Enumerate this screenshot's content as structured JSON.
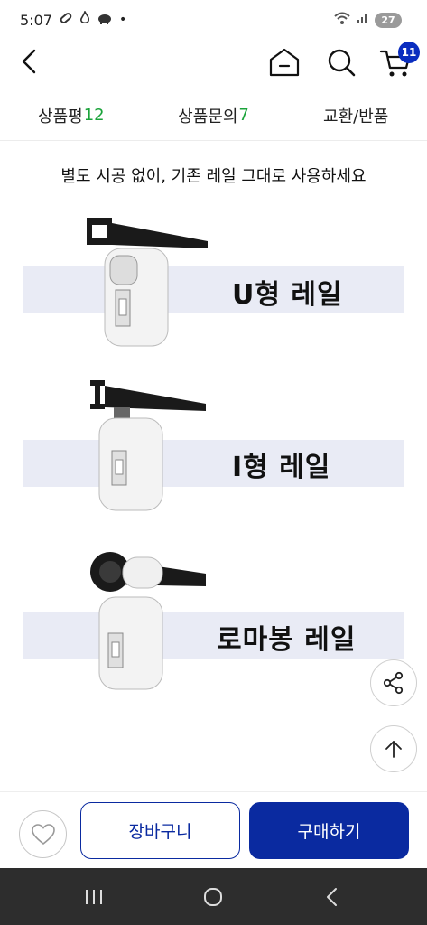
{
  "status_bar": {
    "time": "5:07",
    "dot": "•",
    "battery": "27",
    "icons": [
      "link-icon",
      "fire-icon",
      "piggy-icon",
      "wifi-icon",
      "signal-icon",
      "battery-icon"
    ]
  },
  "header": {
    "cart_count": "11",
    "icons": [
      "back-icon",
      "home-icon",
      "search-icon",
      "cart-icon"
    ]
  },
  "tabs": [
    {
      "label": "상품평",
      "count": "12"
    },
    {
      "label": "상품문의",
      "count": "7"
    },
    {
      "label": "교환/반품",
      "count": ""
    }
  ],
  "content": {
    "intro": "별도 시공 없이, 기존 레일 그대로 사용하세요",
    "rails": [
      {
        "label": "U형 레일"
      },
      {
        "label": "I형 레일"
      },
      {
        "label": "로마봉 레일"
      }
    ]
  },
  "floating": {
    "icons": [
      "share-icon",
      "arrow-up-icon"
    ]
  },
  "bottom_bar": {
    "cart_label": "장바구니",
    "buy_label": "구매하기",
    "icons": [
      "heart-icon"
    ]
  },
  "nav_bar": {
    "icons": [
      "recent-apps-icon",
      "home-circle-icon",
      "nav-back-icon"
    ]
  },
  "colors": {
    "primary": "#0a2aa0",
    "count_green": "#1aa33a",
    "band": "#e9ebf5"
  }
}
